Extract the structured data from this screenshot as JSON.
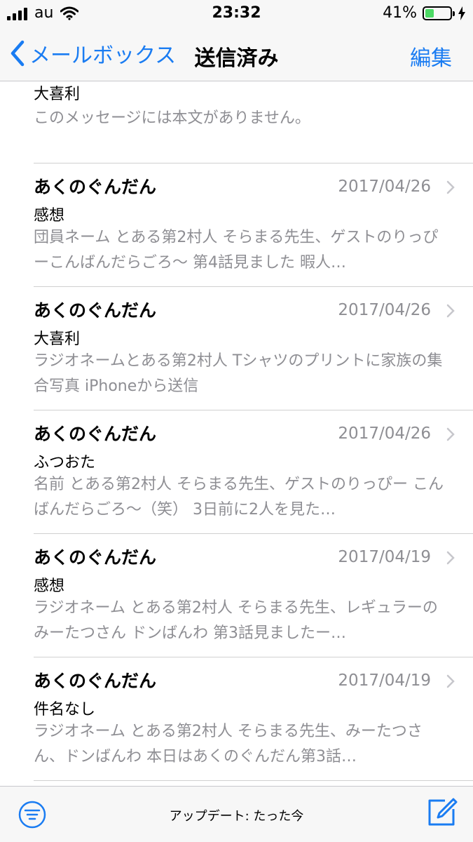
{
  "status_bar": {
    "carrier": "au",
    "time": "23:32",
    "battery_percent": "41%",
    "battery_level": 0.41,
    "accent": "#4cd964"
  },
  "nav": {
    "back_label": "メールボックス",
    "title": "送信済み",
    "edit_label": "編集",
    "accent": "#1a7cf2"
  },
  "partial_item": {
    "subject": "大喜利",
    "preview": "このメッセージには本文がありません。"
  },
  "mails": [
    {
      "sender": "あくのぐんだん",
      "date": "2017/04/26",
      "subject": "感想",
      "preview": "団員ネーム とある第2村人 そらまる先生、ゲストのりっぴーこんばんだらごろ〜 第4話見ました 暇人…"
    },
    {
      "sender": "あくのぐんだん",
      "date": "2017/04/26",
      "subject": "大喜利",
      "preview": "ラジオネームとある第2村人 Tシャツのプリントに家族の集合写真 iPhoneから送信"
    },
    {
      "sender": "あくのぐんだん",
      "date": "2017/04/26",
      "subject": "ふつおた",
      "preview": "名前 とある第2村人 そらまる先生、ゲストのりっぴー こんばんだらごろ〜（笑） 3日前に2人を見た…"
    },
    {
      "sender": "あくのぐんだん",
      "date": "2017/04/19",
      "subject": "感想",
      "preview": "ラジオネーム とある第2村人 そらまる先生、レギュラーのみーたつさん ドンばんわ 第3話見ましたー…"
    },
    {
      "sender": "あくのぐんだん",
      "date": "2017/04/19",
      "subject": "件名なし",
      "preview": "ラジオネーム とある第2村人 そらまる先生、みーたつさん、ドンばんわ 本日はあくのぐんだん第3話…"
    }
  ],
  "toolbar": {
    "status": "アップデート: たった今",
    "filter_icon": "filter-icon",
    "compose_icon": "compose-icon"
  }
}
